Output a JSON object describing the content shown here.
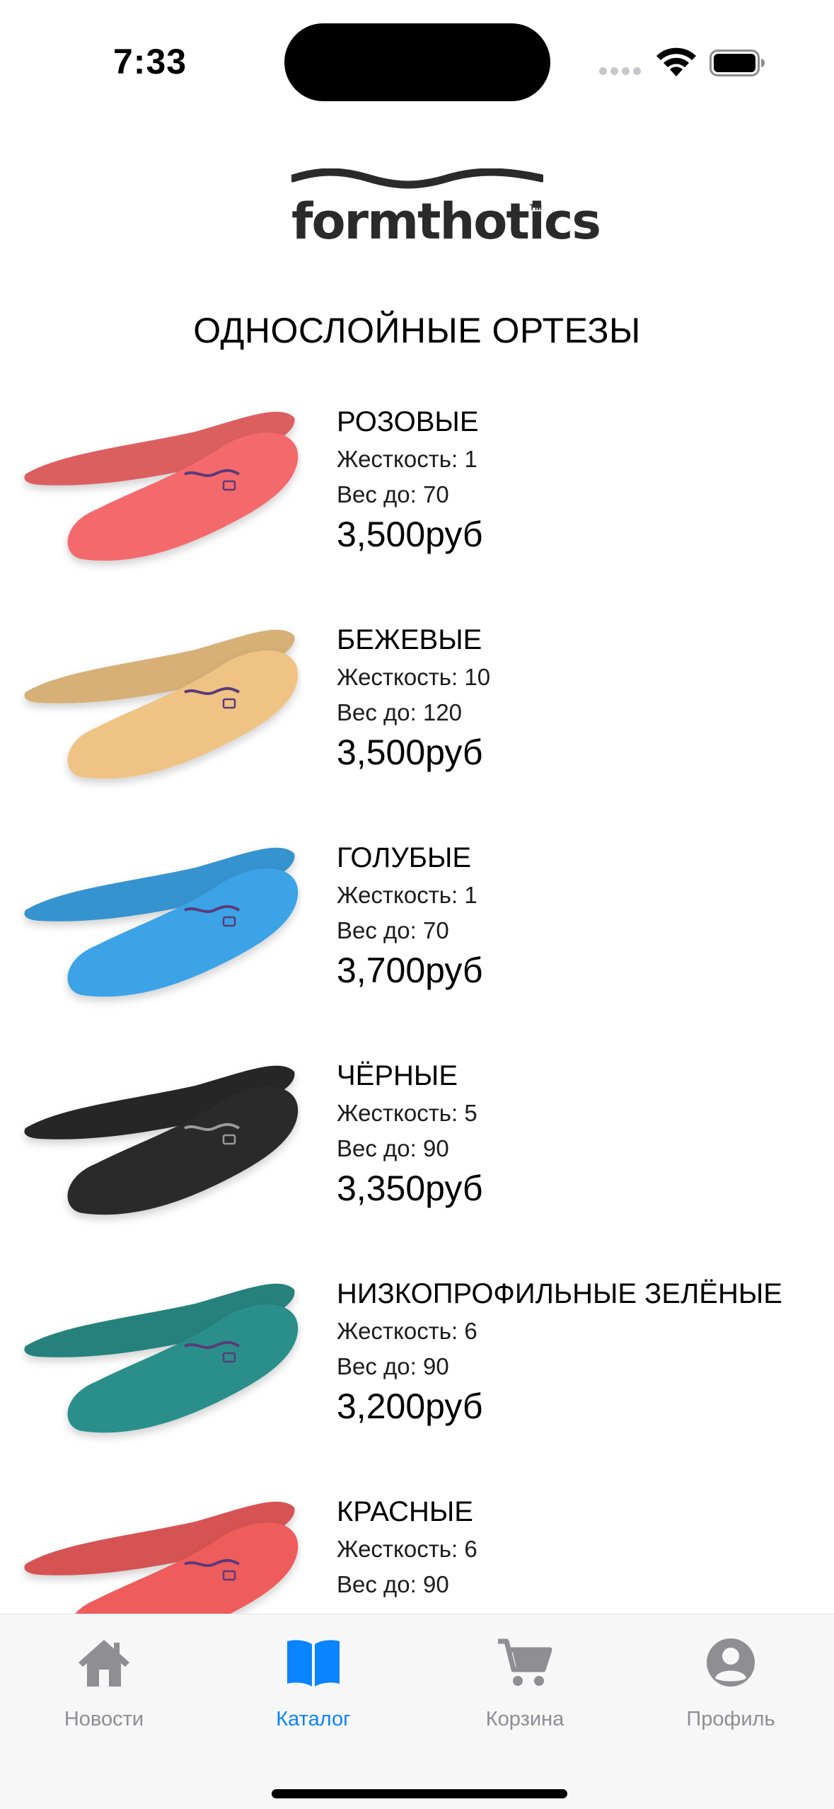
{
  "status": {
    "time": "7:33"
  },
  "logo": {
    "text": "formthotics",
    "tm": "TM"
  },
  "section_title": "ОДНОСЛОЙНЫЕ ОРТЕЗЫ",
  "products": [
    {
      "name": "РОЗОВЫЕ",
      "stiffness": "Жесткость: 1",
      "weight": "Вес до: 70",
      "price": "3,500руб",
      "color": "#f46a6c"
    },
    {
      "name": "БЕЖЕВЫЕ",
      "stiffness": "Жесткость: 10",
      "weight": "Вес до: 120",
      "price": "3,500руб",
      "color": "#efc384"
    },
    {
      "name": "ГОЛУБЫЕ",
      "stiffness": "Жесткость: 1",
      "weight": "Вес до: 70",
      "price": "3,700руб",
      "color": "#3aa3e6"
    },
    {
      "name": "ЧЁРНЫЕ",
      "stiffness": "Жесткость: 5",
      "weight": "Вес до: 90",
      "price": "3,350руб",
      "color": "#2a2a2c"
    },
    {
      "name": "НИЗКОПРОФИЛЬНЫЕ ЗЕЛЁНЫЕ",
      "stiffness": "Жесткость: 6",
      "weight": "Вес до: 90",
      "price": "3,200руб",
      "color": "#2a8f8a"
    },
    {
      "name": "КРАСНЫЕ",
      "stiffness": "Жесткость: 6",
      "weight": "Вес до: 90",
      "price": "",
      "color": "#ee5c5c"
    }
  ],
  "tabs": [
    {
      "label": "Новости",
      "icon": "house-icon",
      "active": false
    },
    {
      "label": "Каталог",
      "icon": "book-icon",
      "active": true
    },
    {
      "label": "Корзина",
      "icon": "cart-icon",
      "active": false
    },
    {
      "label": "Профиль",
      "icon": "person-icon",
      "active": false
    }
  ],
  "colors": {
    "accent": "#0a84ff",
    "inactive": "#8e8e93"
  }
}
